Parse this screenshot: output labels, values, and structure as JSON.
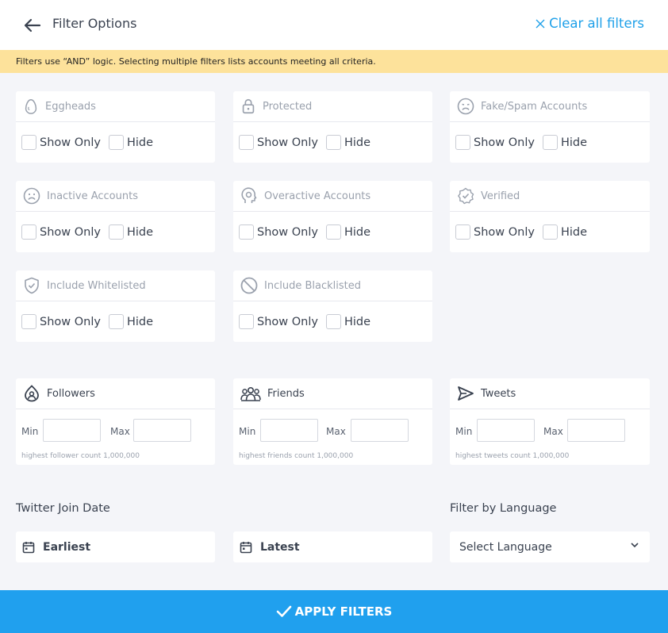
{
  "header": {
    "title": "Filter Options",
    "clear_label": "Clear all filters"
  },
  "notice": "Filters use “AND” logic. Selecting multiple filters lists accounts meeting all criteria.",
  "toggle_filters": [
    {
      "label": "Eggheads",
      "icon": "egg-icon",
      "show_only": "Show Only",
      "hide": "Hide"
    },
    {
      "label": "Protected",
      "icon": "lock-icon",
      "show_only": "Show Only",
      "hide": "Hide"
    },
    {
      "label": "Fake/Spam Accounts",
      "icon": "frown-face-icon",
      "show_only": "Show Only",
      "hide": "Hide"
    },
    {
      "label": "Inactive Accounts",
      "icon": "sad-face-icon",
      "show_only": "Show Only",
      "hide": "Hide"
    },
    {
      "label": "Overactive Accounts",
      "icon": "overactive-icon",
      "show_only": "Show Only",
      "hide": "Hide"
    },
    {
      "label": "Verified",
      "icon": "verified-badge-icon",
      "show_only": "Show Only",
      "hide": "Hide"
    },
    {
      "label": "Include Whitelisted",
      "icon": "shield-check-icon",
      "show_only": "Show Only",
      "hide": "Hide"
    },
    {
      "label": "Include Blacklisted",
      "icon": "ban-icon",
      "show_only": "Show Only",
      "hide": "Hide"
    }
  ],
  "range_filters": [
    {
      "label": "Followers",
      "icon": "followers-icon",
      "min_label": "Min",
      "max_label": "Max",
      "hint": "highest follower count 1,000,000"
    },
    {
      "label": "Friends",
      "icon": "friends-icon",
      "min_label": "Min",
      "max_label": "Max",
      "hint": "highest friends count 1,000,000"
    },
    {
      "label": "Tweets",
      "icon": "send-icon",
      "min_label": "Min",
      "max_label": "Max",
      "hint": "highest tweets count 1,000,000"
    }
  ],
  "join_date": {
    "title": "Twitter Join Date",
    "earliest": "Earliest",
    "latest": "Latest"
  },
  "language": {
    "title": "Filter by Language",
    "selected": "Select Language"
  },
  "apply_label": "APPLY FILTERS",
  "colors": {
    "accent": "#1ea0e9",
    "apply_bg": "#20a0ee",
    "notice_bg": "#fde29b",
    "page_bg": "#f4f5f9"
  }
}
